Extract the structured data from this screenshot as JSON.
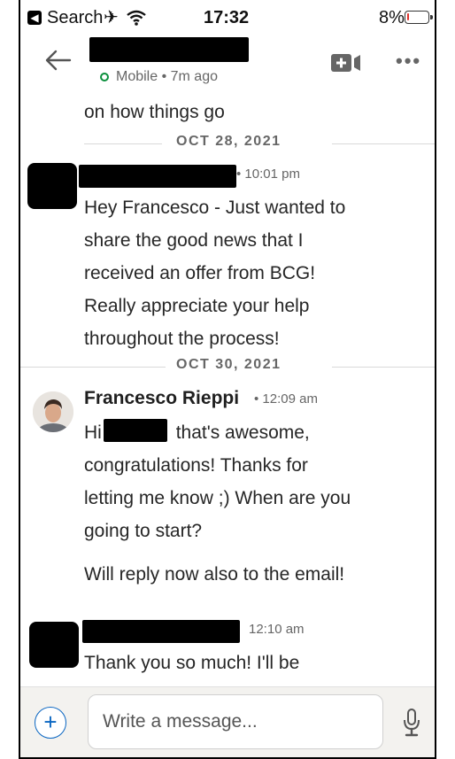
{
  "status_bar": {
    "back_app_label": "Search",
    "time": "17:32",
    "battery_percent": "8%",
    "battery_level": 0.08,
    "icons": [
      "back-app-icon",
      "airplane-icon",
      "wifi-icon",
      "battery-icon"
    ]
  },
  "header": {
    "presence": "Mobile • 7m ago",
    "presence_color": "#0a8f3c",
    "icons": [
      "back-arrow-icon",
      "video-call-icon",
      "more-options-icon"
    ]
  },
  "conversation": {
    "top_fragment": "on how things go",
    "dates": [
      "OCT 28, 2021",
      "OCT 30, 2021"
    ],
    "messages": [
      {
        "time": "• 10:01 pm",
        "lines": [
          "Hey Francesco - Just wanted to",
          "share the good news that I",
          "received an offer from BCG!",
          "Really appreciate your help",
          "throughout the process!"
        ]
      },
      {
        "sender": "Francesco Rieppi",
        "time": "• 12:09 am",
        "first_line_prefix": "Hi",
        "first_line_suffix": "that's awesome,",
        "lines": [
          "congratulations! Thanks for",
          "letting me know ;) When are you",
          "going to start?"
        ],
        "second_paragraph": "Will reply now also to the email!"
      },
      {
        "time": "12:10 am",
        "lines": [
          "Thank you so much! I'll be"
        ]
      }
    ]
  },
  "composer": {
    "placeholder": "Write a message...",
    "add_label": "+",
    "accent": "#0a66c2"
  }
}
